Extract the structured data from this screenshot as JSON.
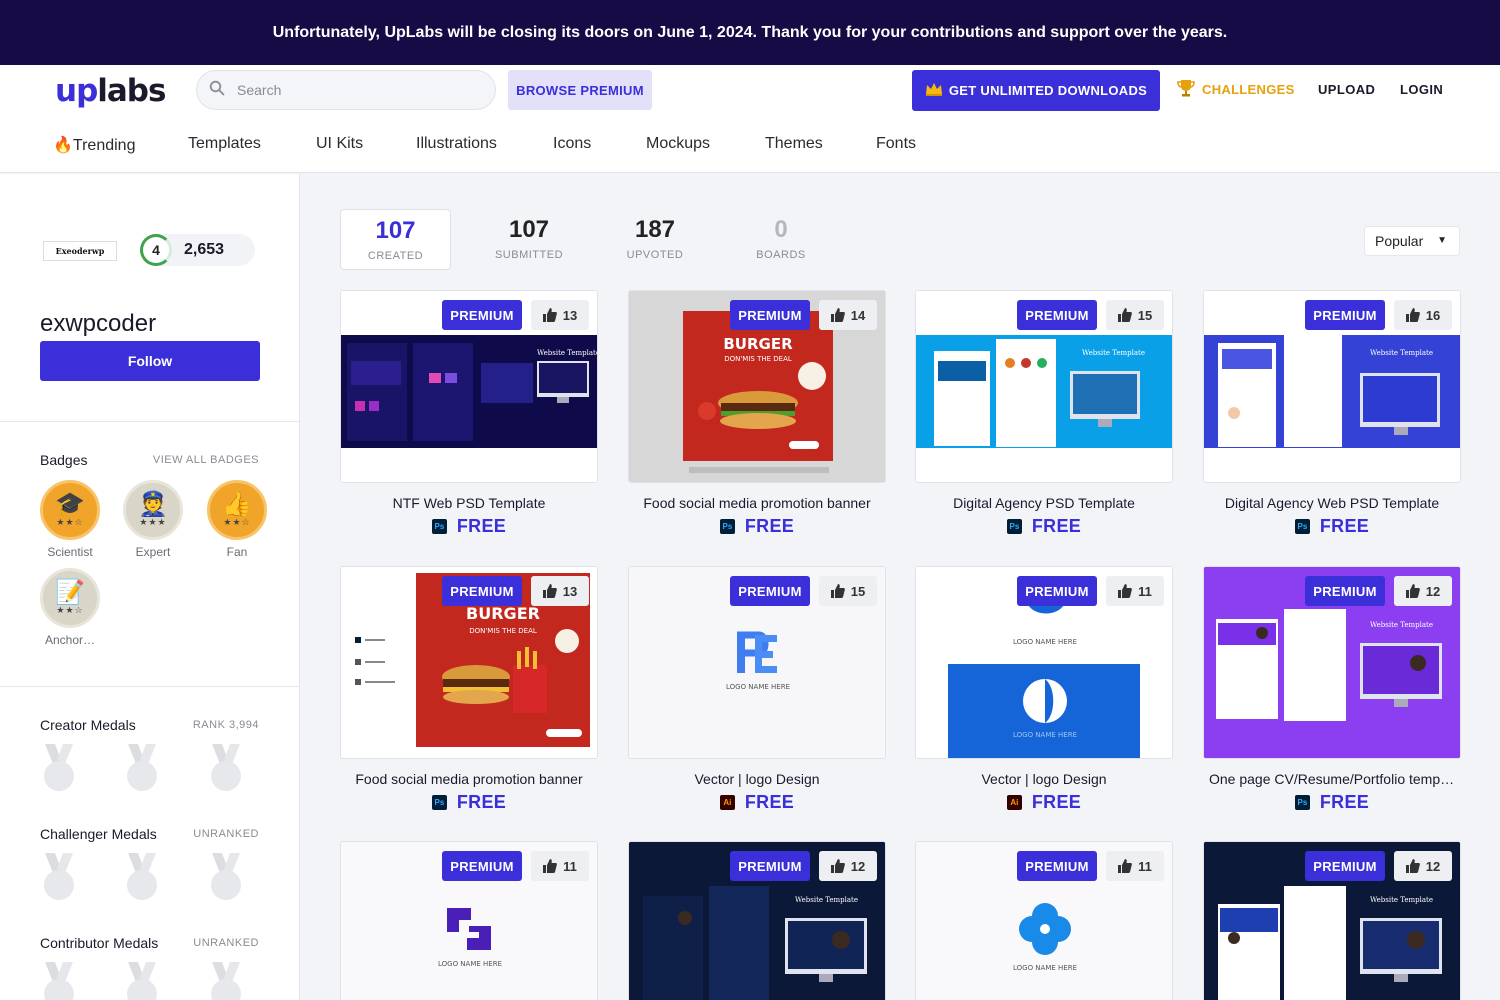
{
  "banner": {
    "text": "Unfortunately, UpLabs will be closing its doors on June 1, 2024. Thank you for your contributions and support over the years."
  },
  "header": {
    "logo_up": "up",
    "logo_labs": "labs",
    "search_placeholder": "Search",
    "browse_premium": "BROWSE PREMIUM",
    "unlimited": "GET UNLIMITED DOWNLOADS",
    "challenges": "CHALLENGES",
    "upload": "UPLOAD",
    "login": "LOGIN",
    "accent": "#3a2fd8"
  },
  "categories": [
    "Trending",
    "Templates",
    "UI Kits",
    "Illustrations",
    "Icons",
    "Mockups",
    "Themes",
    "Fonts"
  ],
  "profile": {
    "avatar_text": "Exeoderwp",
    "level": "4",
    "score": "2,653",
    "username": "exwpcoder",
    "follow": "Follow",
    "badges_title": "Badges",
    "view_all_badges": "VIEW ALL BADGES",
    "badges": [
      {
        "name": "Scientist",
        "icon": "graduation-cap-icon",
        "color": "#f0a52a"
      },
      {
        "name": "Expert",
        "icon": "officer-icon",
        "color": "#d9d5c7"
      },
      {
        "name": "Fan",
        "icon": "thumbs-up-icon",
        "color": "#f0a52a"
      },
      {
        "name": "Anchor…",
        "icon": "notepad-icon",
        "color": "#d9d5c7"
      }
    ],
    "creator_medals": "Creator Medals",
    "creator_rank": "RANK 3,994",
    "challenger_medals": "Challenger Medals",
    "challenger_rank": "UNRANKED",
    "contributor_medals": "Contributor Medals",
    "contributor_rank": "UNRANKED"
  },
  "stats": [
    {
      "num": "107",
      "label": "CREATED"
    },
    {
      "num": "107",
      "label": "SUBMITTED"
    },
    {
      "num": "187",
      "label": "UPVOTED"
    },
    {
      "num": "0",
      "label": "BOARDS"
    }
  ],
  "sort": "Popular",
  "premium_label": "PREMIUM",
  "cards": [
    {
      "title": "NTF Web PSD Template",
      "likes": "13",
      "type": "Ps",
      "price": "FREE"
    },
    {
      "title": "Food social media promotion banner",
      "likes": "14",
      "type": "Ps",
      "price": "FREE"
    },
    {
      "title": "Digital Agency PSD Template",
      "likes": "15",
      "type": "Ps",
      "price": "FREE"
    },
    {
      "title": "Digital Agency Web PSD Template",
      "likes": "16",
      "type": "Ps",
      "price": "FREE"
    },
    {
      "title": "Food social media promotion banner",
      "likes": "13",
      "type": "Ps",
      "price": "FREE"
    },
    {
      "title": "Vector | logo Design",
      "likes": "15",
      "type": "Ai",
      "price": "FREE"
    },
    {
      "title": "Vector | logo Design",
      "likes": "11",
      "type": "Ai",
      "price": "FREE"
    },
    {
      "title": "One page CV/Resume/Portfolio template",
      "likes": "12",
      "type": "Ps",
      "price": "FREE"
    },
    {
      "title": "",
      "likes": "11",
      "type": "",
      "price": ""
    },
    {
      "title": "",
      "likes": "12",
      "type": "",
      "price": ""
    },
    {
      "title": "",
      "likes": "11",
      "type": "",
      "price": ""
    },
    {
      "title": "",
      "likes": "12",
      "type": "",
      "price": ""
    }
  ],
  "thumb_text": {
    "website_template": "Website Template",
    "burger": "BURGER",
    "dont_miss": "DON'MIS THE DEAL",
    "logo_name_here": "LOGO NAME HERE"
  }
}
